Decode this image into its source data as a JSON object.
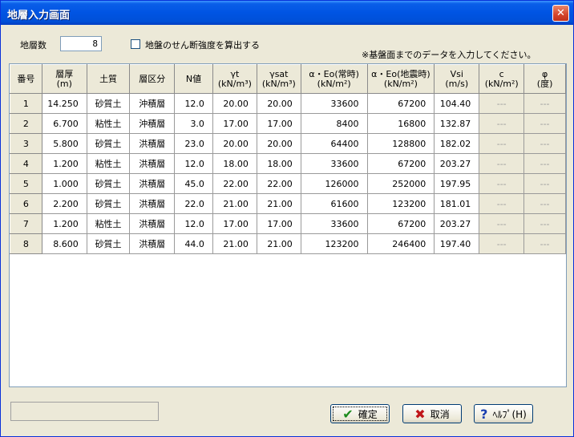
{
  "window": {
    "title": "地層入力画面",
    "close_glyph": "✕"
  },
  "form": {
    "layer_count_label": "地層数",
    "layer_count_value": "8",
    "checkbox_label": "地盤のせん断強度を算出する",
    "notice": "※基盤面までのデータを入力してください。"
  },
  "table": {
    "headers": [
      {
        "l1": "番号",
        "l2": ""
      },
      {
        "l1": "層厚",
        "l2": "(m)"
      },
      {
        "l1": "土質",
        "l2": ""
      },
      {
        "l1": "層区分",
        "l2": ""
      },
      {
        "l1": "N値",
        "l2": ""
      },
      {
        "l1": "γt",
        "l2": "(kN/m³)"
      },
      {
        "l1": "γsat",
        "l2": "(kN/m³)"
      },
      {
        "l1": "α・Eo(常時)",
        "l2": "(kN/m²)"
      },
      {
        "l1": "α・Eo(地震時)",
        "l2": "(kN/m²)"
      },
      {
        "l1": "Vsi",
        "l2": "(m/s)"
      },
      {
        "l1": "c",
        "l2": "(kN/m²)"
      },
      {
        "l1": "φ",
        "l2": "(度)"
      }
    ],
    "rows": [
      {
        "no": "1",
        "thick": "14.250",
        "soil": "砂質土",
        "zone": "沖積層",
        "n": "12.0",
        "gt": "20.00",
        "gsat": "20.00",
        "eo1": "33600",
        "eo2": "67200",
        "vsi": "104.40",
        "c": "---",
        "phi": "---"
      },
      {
        "no": "2",
        "thick": "6.700",
        "soil": "粘性土",
        "zone": "沖積層",
        "n": "3.0",
        "gt": "17.00",
        "gsat": "17.00",
        "eo1": "8400",
        "eo2": "16800",
        "vsi": "132.87",
        "c": "---",
        "phi": "---"
      },
      {
        "no": "3",
        "thick": "5.800",
        "soil": "砂質土",
        "zone": "洪積層",
        "n": "23.0",
        "gt": "20.00",
        "gsat": "20.00",
        "eo1": "64400",
        "eo2": "128800",
        "vsi": "182.02",
        "c": "---",
        "phi": "---"
      },
      {
        "no": "4",
        "thick": "1.200",
        "soil": "粘性土",
        "zone": "洪積層",
        "n": "12.0",
        "gt": "18.00",
        "gsat": "18.00",
        "eo1": "33600",
        "eo2": "67200",
        "vsi": "203.27",
        "c": "---",
        "phi": "---"
      },
      {
        "no": "5",
        "thick": "1.000",
        "soil": "砂質土",
        "zone": "洪積層",
        "n": "45.0",
        "gt": "22.00",
        "gsat": "22.00",
        "eo1": "126000",
        "eo2": "252000",
        "vsi": "197.95",
        "c": "---",
        "phi": "---"
      },
      {
        "no": "6",
        "thick": "2.200",
        "soil": "砂質土",
        "zone": "洪積層",
        "n": "22.0",
        "gt": "21.00",
        "gsat": "21.00",
        "eo1": "61600",
        "eo2": "123200",
        "vsi": "181.01",
        "c": "---",
        "phi": "---"
      },
      {
        "no": "7",
        "thick": "1.200",
        "soil": "粘性土",
        "zone": "洪積層",
        "n": "12.0",
        "gt": "17.00",
        "gsat": "17.00",
        "eo1": "33600",
        "eo2": "67200",
        "vsi": "203.27",
        "c": "---",
        "phi": "---"
      },
      {
        "no": "8",
        "thick": "8.600",
        "soil": "砂質土",
        "zone": "洪積層",
        "n": "44.0",
        "gt": "21.00",
        "gsat": "21.00",
        "eo1": "123200",
        "eo2": "246400",
        "vsi": "197.40",
        "c": "---",
        "phi": "---"
      }
    ]
  },
  "buttons": {
    "ok": {
      "label": "確定",
      "icon": "check-icon"
    },
    "cancel": {
      "label": "取消",
      "icon": "x-icon"
    },
    "help": {
      "label": "ﾍﾙﾌﾟ(H)",
      "icon": "question-icon"
    }
  },
  "colors": {
    "title_bar": "#0054e3",
    "dialog_bg": "#ece9d8",
    "disabled_text": "#9a9a9a"
  }
}
